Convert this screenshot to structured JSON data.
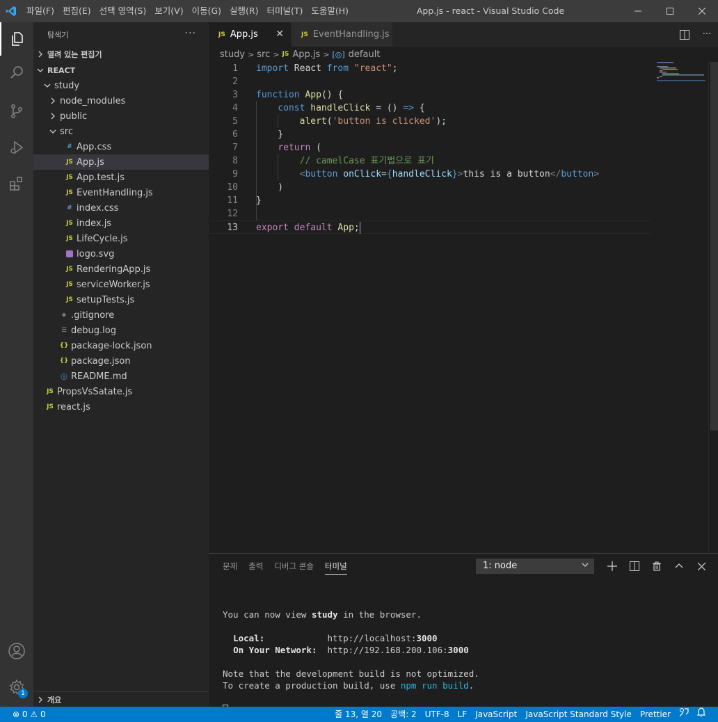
{
  "titlebar": {
    "menus": [
      "파일(F)",
      "편집(E)",
      "선택 영역(S)",
      "보기(V)",
      "이동(G)",
      "실행(R)",
      "터미널(T)",
      "도움말(H)"
    ],
    "window_title": "App.js - react - Visual Studio Code"
  },
  "activitybar": {
    "items": [
      "explorer-icon",
      "search-icon",
      "source-control-icon",
      "run-debug-icon",
      "extensions-icon"
    ],
    "bottom_items": [
      "accounts-icon",
      "settings-gear-icon"
    ],
    "settings_badge": "1"
  },
  "sidebar": {
    "title": "탐색기",
    "open_editors_label": "열려 있는 편집기",
    "workspace_label": "REACT",
    "outline_label": "개요",
    "tree": [
      {
        "label": "study",
        "kind": "folder-open",
        "depth": 1
      },
      {
        "label": "node_modules",
        "kind": "folder-closed",
        "depth": 2
      },
      {
        "label": "public",
        "kind": "folder-closed",
        "depth": 2
      },
      {
        "label": "src",
        "kind": "folder-open",
        "depth": 2
      },
      {
        "label": "App.css",
        "kind": "css",
        "depth": 3
      },
      {
        "label": "App.js",
        "kind": "js",
        "depth": 3,
        "selected": true
      },
      {
        "label": "App.test.js",
        "kind": "js",
        "depth": 3
      },
      {
        "label": "EventHandling.js",
        "kind": "js",
        "depth": 3
      },
      {
        "label": "index.css",
        "kind": "css",
        "depth": 3
      },
      {
        "label": "index.js",
        "kind": "js",
        "depth": 3
      },
      {
        "label": "LifeCycle.js",
        "kind": "js",
        "depth": 3
      },
      {
        "label": "logo.svg",
        "kind": "svg",
        "depth": 3
      },
      {
        "label": "RenderingApp.js",
        "kind": "js",
        "depth": 3
      },
      {
        "label": "serviceWorker.js",
        "kind": "js",
        "depth": 3
      },
      {
        "label": "setupTests.js",
        "kind": "js",
        "depth": 3
      },
      {
        "label": ".gitignore",
        "kind": "git",
        "depth": 2
      },
      {
        "label": "debug.log",
        "kind": "log",
        "depth": 2
      },
      {
        "label": "package-lock.json",
        "kind": "json",
        "depth": 2
      },
      {
        "label": "package.json",
        "kind": "json",
        "depth": 2
      },
      {
        "label": "README.md",
        "kind": "info",
        "depth": 2
      },
      {
        "label": "PropsVsSatate.js",
        "kind": "js",
        "depth": 1
      },
      {
        "label": "react.js",
        "kind": "js",
        "depth": 1
      }
    ]
  },
  "editor": {
    "tabs": [
      {
        "label": "App.js",
        "active": true
      },
      {
        "label": "EventHandling.js",
        "active": false
      }
    ],
    "breadcrumb": [
      "study",
      "src",
      "App.js",
      "default"
    ],
    "js_badge": "JS",
    "cursor_line": 13,
    "code_lines": [
      [
        [
          "kw",
          "import"
        ],
        [
          "id",
          " React "
        ],
        [
          "kw",
          "from"
        ],
        [
          "id",
          " "
        ],
        [
          "str",
          "\"react\""
        ],
        [
          "id",
          ";"
        ]
      ],
      [],
      [
        [
          "kw",
          "function"
        ],
        [
          "id",
          " "
        ],
        [
          "fn",
          "App"
        ],
        [
          "id",
          "() {"
        ]
      ],
      [
        [
          "id",
          "    "
        ],
        [
          "kw",
          "const"
        ],
        [
          "id",
          " "
        ],
        [
          "fn",
          "handleClick"
        ],
        [
          "id",
          " = () "
        ],
        [
          "kw",
          "=>"
        ],
        [
          "id",
          " {"
        ]
      ],
      [
        [
          "id",
          "        "
        ],
        [
          "fn",
          "alert"
        ],
        [
          "id",
          "("
        ],
        [
          "str",
          "'button is clicked'"
        ],
        [
          "id",
          ");"
        ]
      ],
      [
        [
          "id",
          "    }"
        ]
      ],
      [
        [
          "id",
          "    "
        ],
        [
          "ctl",
          "return"
        ],
        [
          "id",
          " ("
        ]
      ],
      [
        [
          "id",
          "        "
        ],
        [
          "cmt",
          "// camelCase 표기법으로 표기"
        ]
      ],
      [
        [
          "id",
          "        "
        ],
        [
          "brk",
          "<"
        ],
        [
          "tag",
          "button"
        ],
        [
          "id",
          " "
        ],
        [
          "attr",
          "onClick"
        ],
        [
          "id",
          "="
        ],
        [
          "kw",
          "{"
        ],
        [
          "var",
          "handleClick"
        ],
        [
          "kw",
          "}"
        ],
        [
          "brk",
          ">"
        ],
        [
          "id",
          "this is a button"
        ],
        [
          "brk",
          "</"
        ],
        [
          "tag",
          "button"
        ],
        [
          "brk",
          ">"
        ]
      ],
      [
        [
          "id",
          "    )"
        ]
      ],
      [
        [
          "id",
          "}"
        ]
      ],
      [],
      [
        [
          "ctl",
          "export"
        ],
        [
          "id",
          " "
        ],
        [
          "ctl",
          "default"
        ],
        [
          "id",
          " "
        ],
        [
          "fn",
          "App"
        ],
        [
          "id",
          ";"
        ]
      ]
    ]
  },
  "panel": {
    "tabs": [
      "문제",
      "출력",
      "디버그 콘솔",
      "터미널"
    ],
    "active_tab": "터미널",
    "terminal_select": "1: node",
    "terminal_lines": [
      [],
      [
        [
          "n",
          "You can now view "
        ],
        [
          "b",
          "study"
        ],
        [
          "n",
          " in the browser."
        ]
      ],
      [],
      [
        [
          "n",
          "  "
        ],
        [
          "b",
          "Local:"
        ],
        [
          "n",
          "            http://localhost:"
        ],
        [
          "b",
          "3000"
        ]
      ],
      [
        [
          "n",
          "  "
        ],
        [
          "b",
          "On Your Network:"
        ],
        [
          "n",
          "  http://192.168.200.106:"
        ],
        [
          "b",
          "3000"
        ]
      ],
      [],
      [
        [
          "n",
          "Note that the development build is not optimized."
        ]
      ],
      [
        [
          "n",
          "To create a production build, use "
        ],
        [
          "c",
          "npm run build"
        ],
        [
          "n",
          "."
        ]
      ],
      [],
      [
        [
          "cursor",
          ""
        ]
      ]
    ]
  },
  "statusbar": {
    "errors": "0",
    "warnings": "0",
    "position": "줄 13, 열 20",
    "spaces": "공백: 2",
    "encoding": "UTF-8",
    "eol": "LF",
    "language": "JavaScript",
    "linter": "JavaScript Standard Style",
    "formatter": "Prettier"
  },
  "colors": {
    "statusbar": "#007acc",
    "activitybar": "#333333",
    "sidebar": "#252526",
    "editor": "#1e1e1e"
  }
}
